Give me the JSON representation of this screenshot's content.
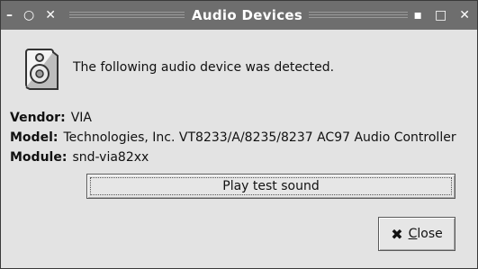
{
  "window": {
    "title": "Audio Devices",
    "controls": {
      "minimize": "–",
      "roll": "○",
      "sticky": "✕",
      "iconify": "▪",
      "maximize": "□",
      "close": "✕"
    }
  },
  "dialog": {
    "intro": "The following audio device was detected.",
    "vendor_label": "Vendor:",
    "vendor_value": "VIA",
    "model_label": "Model:",
    "model_value": "Technologies, Inc. VT8233/A/8235/8237 AC97 Audio Controller",
    "module_label": "Module:",
    "module_value": "snd-via82xx",
    "play_button": "Play test sound",
    "close_button": "Close",
    "icon": "speaker-icon"
  }
}
